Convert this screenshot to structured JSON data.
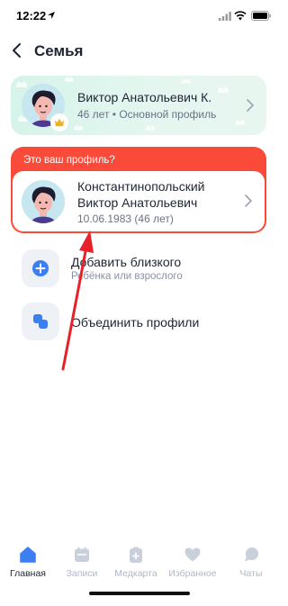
{
  "status_bar": {
    "time": "12:22"
  },
  "header": {
    "title": "Семья"
  },
  "main_profile": {
    "name": "Виктор Анатольевич К.",
    "subtitle": "46 лет • Основной профиль"
  },
  "suggestion": {
    "label": "Это ваш профиль?",
    "name_line1": "Константинопольский",
    "name_line2": "Виктор Анатольевич",
    "birth": "10.06.1983 (46 лет)"
  },
  "actions": [
    {
      "title": "Добавить близкого",
      "subtitle": "Ребёнка или взрослого",
      "icon": "plus-icon"
    },
    {
      "title": "Объединить профили",
      "icon": "merge-icon"
    }
  ],
  "tabs": [
    {
      "label": "Главная",
      "icon": "home-icon",
      "active": true
    },
    {
      "label": "Записи",
      "icon": "calendar-icon"
    },
    {
      "label": "Медкарта",
      "icon": "medcard-icon"
    },
    {
      "label": "Избранное",
      "icon": "heart-icon"
    },
    {
      "label": "Чаты",
      "icon": "chat-icon"
    }
  ],
  "colors": {
    "accent_blue": "#3d7ef2",
    "suggest_red": "#fa4b3a",
    "card_green": "#d6f4ea",
    "crown_gold": "#f2b11c",
    "annotation_red": "#e8202a"
  }
}
